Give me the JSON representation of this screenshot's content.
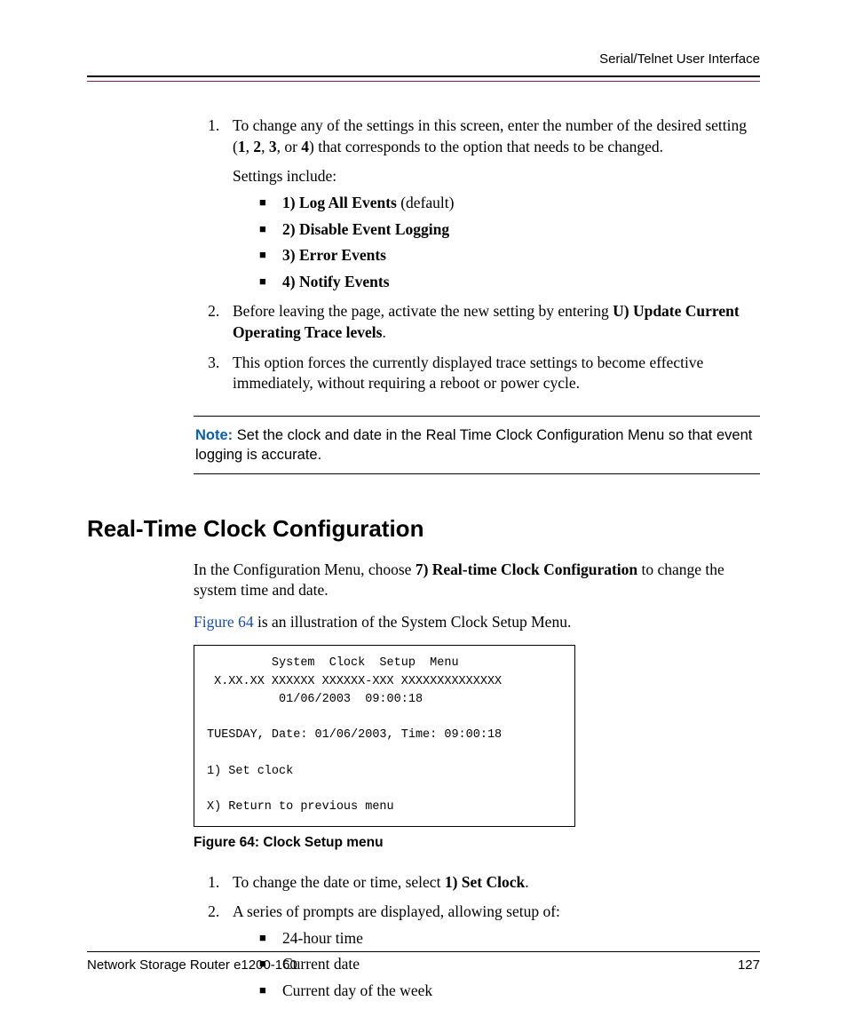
{
  "header": {
    "title": "Serial/Telnet User Interface"
  },
  "list1": {
    "item1_a": "To change any of the settings in this screen, enter the number of the desired setting (",
    "b1": "1",
    "c1": ", ",
    "b2": "2",
    "c2": ", ",
    "b3": "3",
    "c3": ", or ",
    "b4": "4",
    "item1_b": ") that corresponds to the option that needs to be changed.",
    "settings_include": "Settings include:",
    "bullets": {
      "b1_a": "1) Log All Events",
      "b1_b": " (default)",
      "b2": "2) Disable Event Logging",
      "b3": "3) Error Events",
      "b4": "4) Notify Events"
    },
    "item2_a": "Before leaving the page, activate the new setting by entering ",
    "item2_bold": "U) Update Current Operating Trace levels",
    "item2_b": ".",
    "item3": "This option forces the currently displayed trace settings to become effective immediately, without requiring a reboot or power cycle."
  },
  "note": {
    "label": "Note:",
    "text": "  Set the clock and date in the Real Time Clock Configuration Menu so that event logging is accurate."
  },
  "section": {
    "heading": "Real-Time Clock Configuration",
    "p1_a": "In the Configuration Menu, choose ",
    "p1_bold": "7) Real-time Clock Configuration",
    "p1_b": " to change the system time and date.",
    "p2_link": "Figure 64",
    "p2_b": " is an illustration of the System Clock Setup Menu."
  },
  "figure": {
    "line1": "         System  Clock  Setup  Menu",
    "line2": " X.XX.XX XXXXXX XXXXXX-XXX XXXXXXXXXXXXXX",
    "line3": "          01/06/2003  09:00:18",
    "line4": "",
    "line5": "TUESDAY, Date: 01/06/2003, Time: 09:00:18",
    "line6": "",
    "line7": "1) Set clock",
    "line8": "",
    "line9": "X) Return to previous menu",
    "caption": "Figure 64:  Clock Setup menu"
  },
  "list2": {
    "item1_a": "To change the date or time, select ",
    "item1_bold": "1) Set Clock",
    "item1_b": ".",
    "item2": "A series of prompts are displayed, allowing setup of:",
    "bullets": {
      "b1": "24-hour time",
      "b2": "Current date",
      "b3": "Current day of the week"
    }
  },
  "footer": {
    "left": "Network Storage Router e1200-160",
    "right": "127"
  }
}
